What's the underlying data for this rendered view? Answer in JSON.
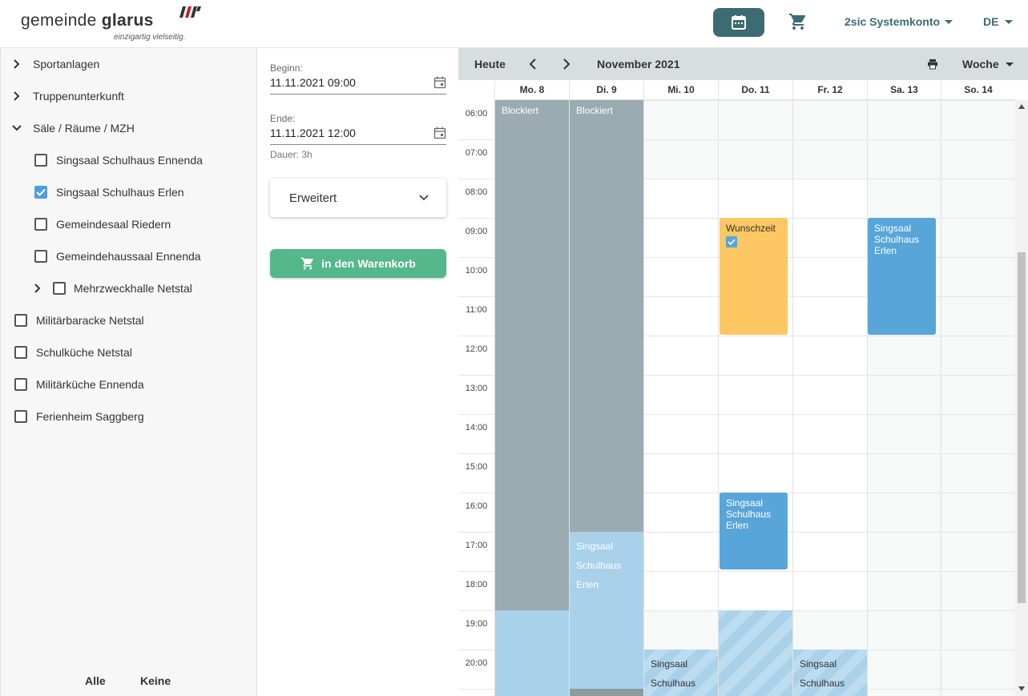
{
  "header": {
    "logo_word_light": "gemeinde ",
    "logo_word_bold": "glarus",
    "logo_tagline": "einzigartig vielseitig.",
    "account_label": "2sic Systemkonto",
    "language": "DE",
    "icons": {
      "calendar": "calendar-icon",
      "cart": "cart-icon"
    },
    "accent_color": "#3d6b74"
  },
  "sidebar": {
    "items": [
      {
        "label": "Sportanlagen"
      },
      {
        "label": "Truppenunterkunft"
      },
      {
        "label": "Säle / Räume / MZH"
      },
      {
        "label": "Singsaal Schulhaus Ennenda"
      },
      {
        "label": "Singsaal Schulhaus Erlen"
      },
      {
        "label": "Gemeindesaal Riedern"
      },
      {
        "label": "Gemeindehaussaal Ennenda"
      },
      {
        "label": "Mehrzweckhalle Netstal"
      },
      {
        "label": "Militärbaracke Netstal"
      },
      {
        "label": "Schulküche Netstal"
      },
      {
        "label": "Militärküche Ennenda"
      },
      {
        "label": "Ferienheim Saggberg"
      }
    ],
    "all_label": "Alle",
    "none_label": "Keine"
  },
  "form": {
    "begin_label": "Beginn:",
    "begin_value": "11.11.2021 09:00",
    "end_label": "Ende:",
    "end_value": "11.11.2021 12:00",
    "duration": "Dauer: 3h",
    "advanced_label": "Erweitert",
    "cart_button_label": "in den Warenkorb",
    "cart_button_color": "#55b78c"
  },
  "calendar": {
    "today_label": "Heute",
    "month_label": "November 2021",
    "view_label": "Woche",
    "days": [
      "Mo. 8",
      "Di. 9",
      "Mi. 10",
      "Do. 11",
      "Fr. 12",
      "Sa. 13",
      "So. 14"
    ],
    "hours": [
      "06:00",
      "07:00",
      "08:00",
      "09:00",
      "10:00",
      "11:00",
      "12:00",
      "13:00",
      "14:00",
      "15:00",
      "16:00",
      "17:00",
      "18:00",
      "19:00",
      "20:00"
    ],
    "events": {
      "blocked_mo": "Blockiert",
      "blocked_di": "Blockiert",
      "di_evening_1": "Singsaal",
      "di_evening_2": "Schulhaus",
      "di_evening_3": "Erlen",
      "wish": "Wunschzeit",
      "sa_booking_1": "Singsaal",
      "sa_booking_2": "Schulhaus",
      "sa_booking_3": "Erlen",
      "do_booking_1": "Singsaal",
      "do_booking_2": "Schulhaus",
      "do_booking_3": "Erlen",
      "mi_evening_1": "Singsaal",
      "mi_evening_2": "Schulhaus",
      "fr_evening_1": "Singsaal",
      "fr_evening_2": "Schulhaus"
    },
    "colors": {
      "blocked": "#9aabb1",
      "booked": "#58a5da",
      "wish": "#fdc763",
      "light": "#a9d1ea"
    }
  }
}
